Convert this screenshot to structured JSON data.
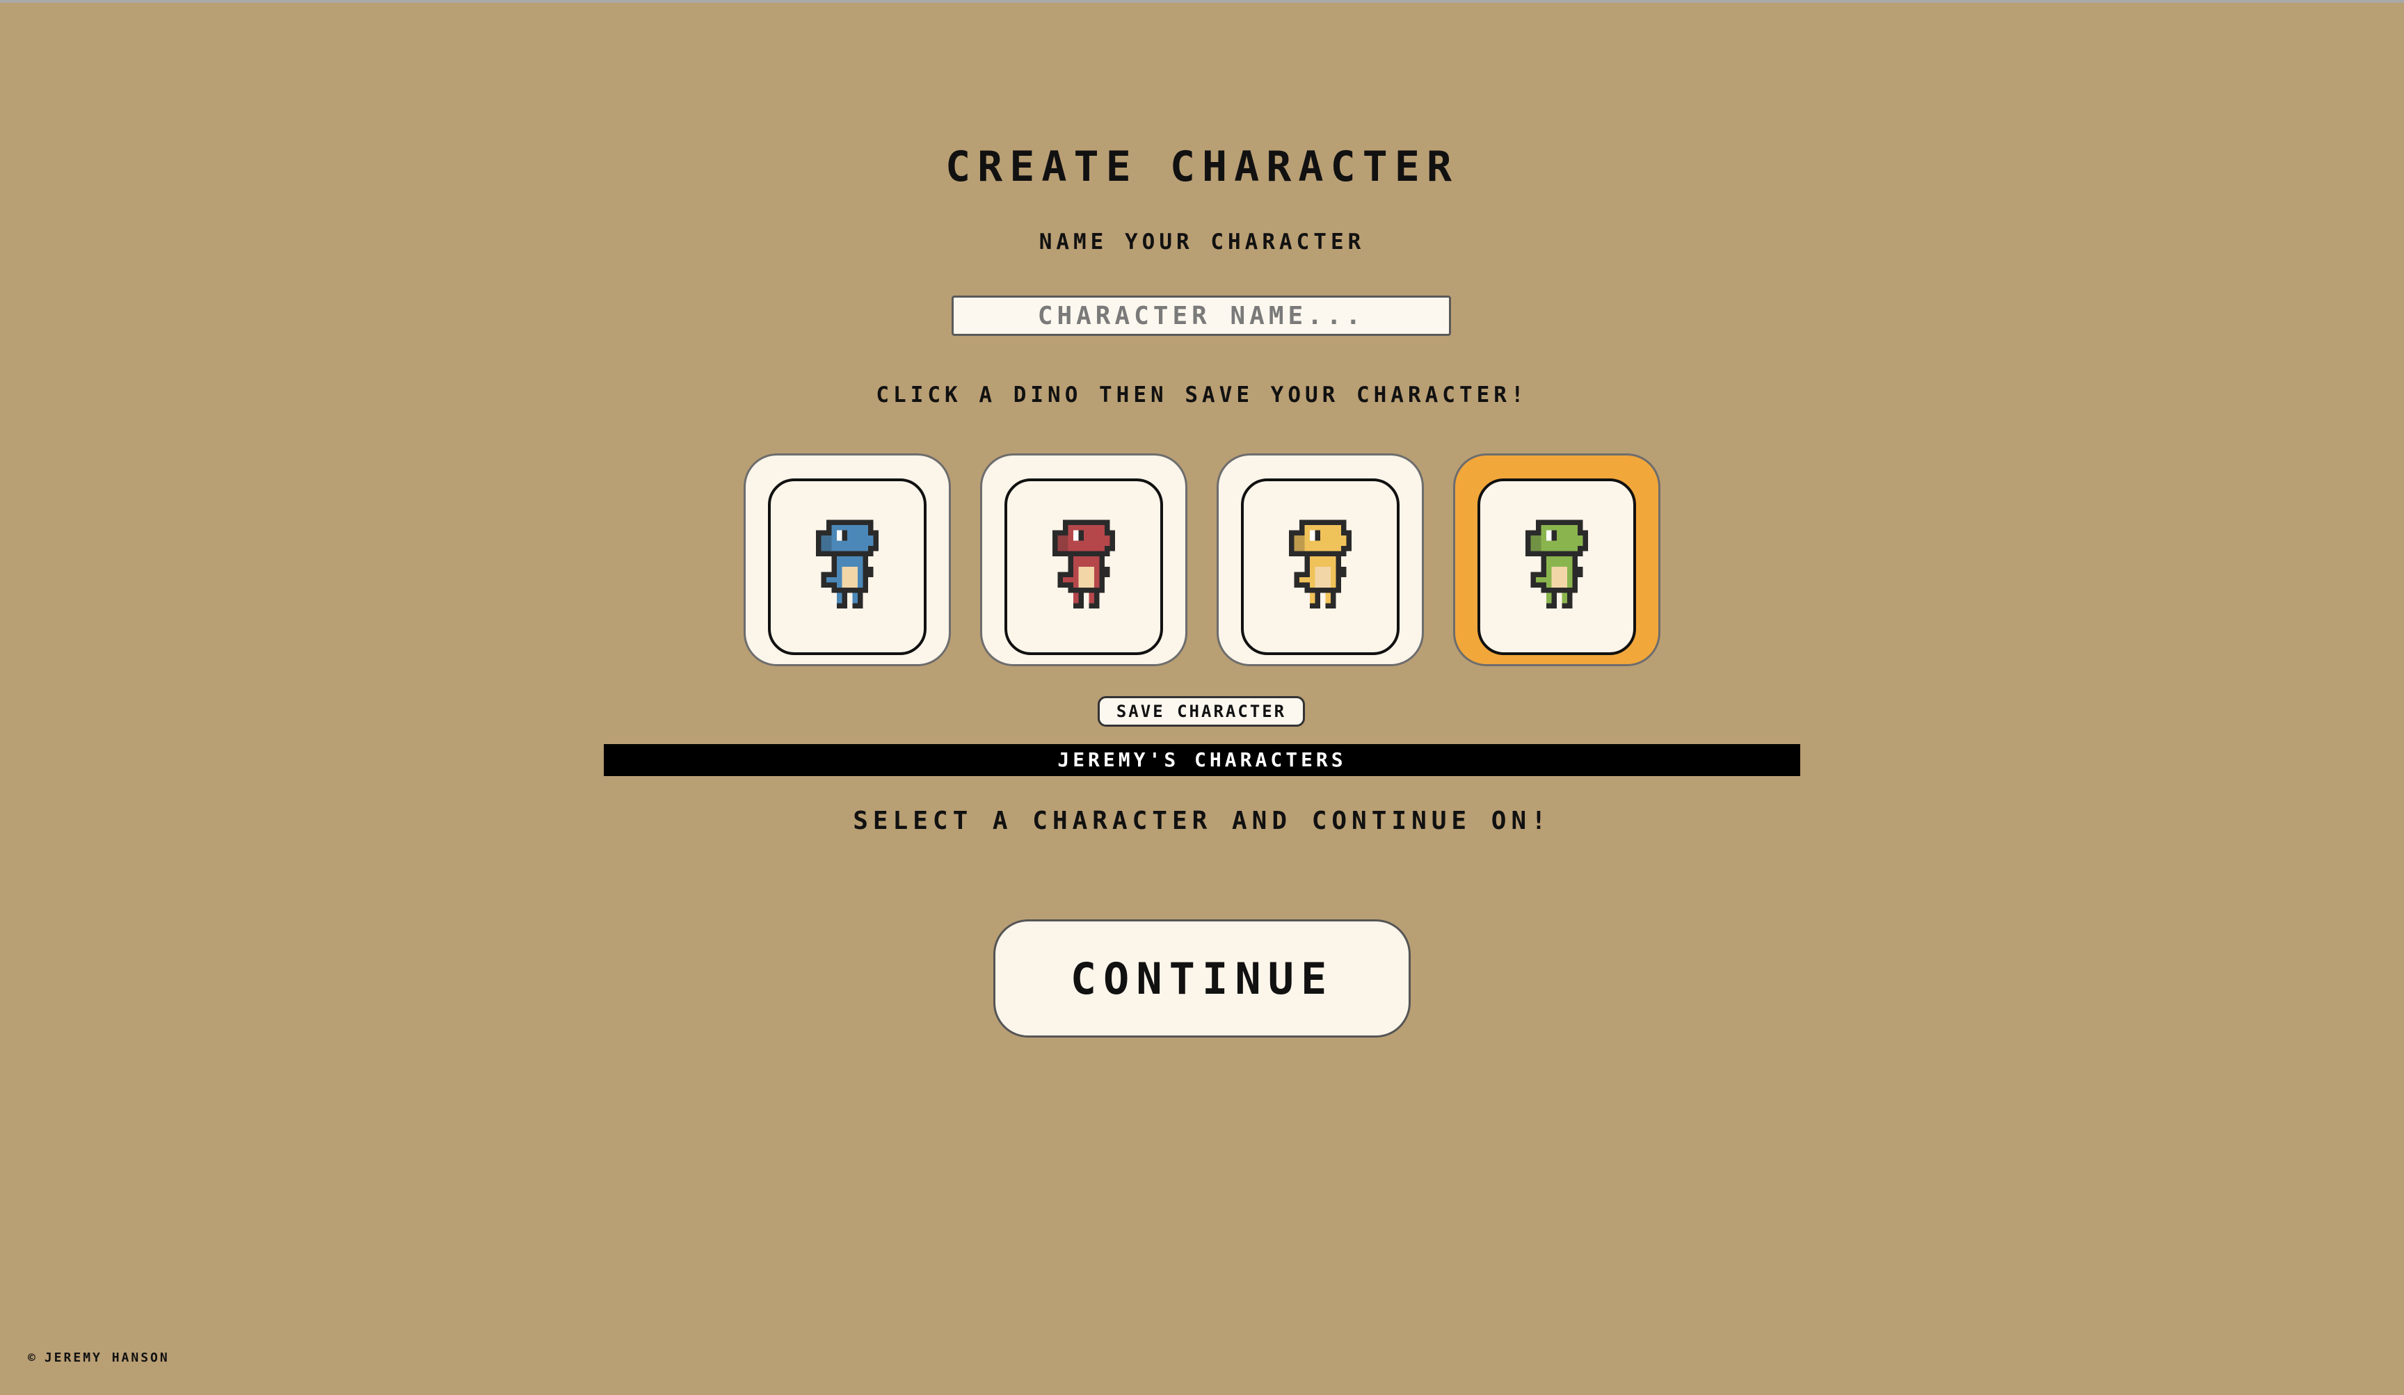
{
  "header": {
    "title": "CREATE CHARACTER",
    "name_prompt": "NAME YOUR CHARACTER"
  },
  "name_input": {
    "placeholder": "CHARACTER NAME...",
    "value": ""
  },
  "instruction": "CLICK A DINO THEN SAVE YOUR CHARACTER!",
  "dinos": [
    {
      "name": "blue-dino-icon",
      "color": "#4b88b8",
      "selected": false
    },
    {
      "name": "red-dino-icon",
      "color": "#b5474b",
      "selected": false
    },
    {
      "name": "yellow-dino-icon",
      "color": "#f0c25a",
      "selected": false
    },
    {
      "name": "green-dino-icon",
      "color": "#8ab54e",
      "selected": true
    }
  ],
  "save_button": "SAVE CHARACTER",
  "roster": {
    "title": "JEREMY'S CHARACTERS"
  },
  "select_prompt": "SELECT A CHARACTER AND CONTINUE ON!",
  "continue_button": "CONTINUE",
  "footer": {
    "copyright_symbol": "©",
    "author": "JEREMY HANSON"
  },
  "colors": {
    "background": "#b99f74",
    "card": "#fcf5ea",
    "selected": "#f2a73a",
    "bar": "#000000"
  }
}
